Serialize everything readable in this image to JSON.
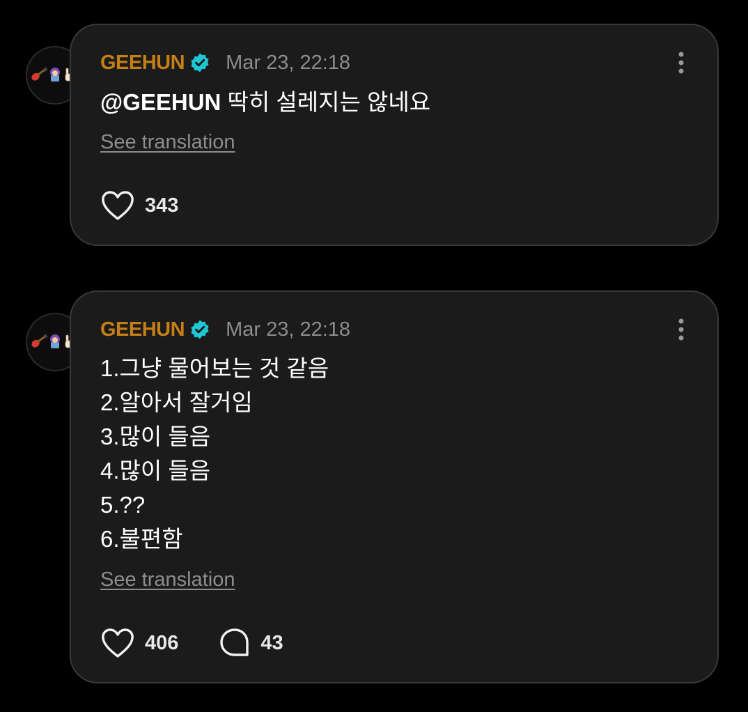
{
  "posts": [
    {
      "username": "GEEHUN",
      "timestamp": "Mar 23, 22:18",
      "mention": "@GEEHUN",
      "text": " 딱히 설레지는 않네요",
      "see_translation": "See translation",
      "likes": "343"
    },
    {
      "username": "GEEHUN",
      "timestamp": "Mar 23, 22:18",
      "lines": [
        "1.그냥 물어보는 것 같음",
        "2.알아서 잘거임",
        "3.많이 들음",
        "4.많이 들음",
        "5.??",
        "6.불편함"
      ],
      "see_translation": "See translation",
      "likes": "406",
      "comments": "43"
    }
  ],
  "colors": {
    "username": "#c67f14",
    "verified_badge": "#1fc7d4",
    "muted_text": "#8d8d8d",
    "card_background": "#1b1b1b",
    "card_border": "#3a3a3a"
  },
  "icons": {
    "verified": "verified-badge-icon",
    "more": "more-vertical-icon",
    "like": "heart-outline-icon",
    "comment": "comment-bubble-icon",
    "avatar": "guitar-person-rock-hand-emoji-avatar"
  }
}
